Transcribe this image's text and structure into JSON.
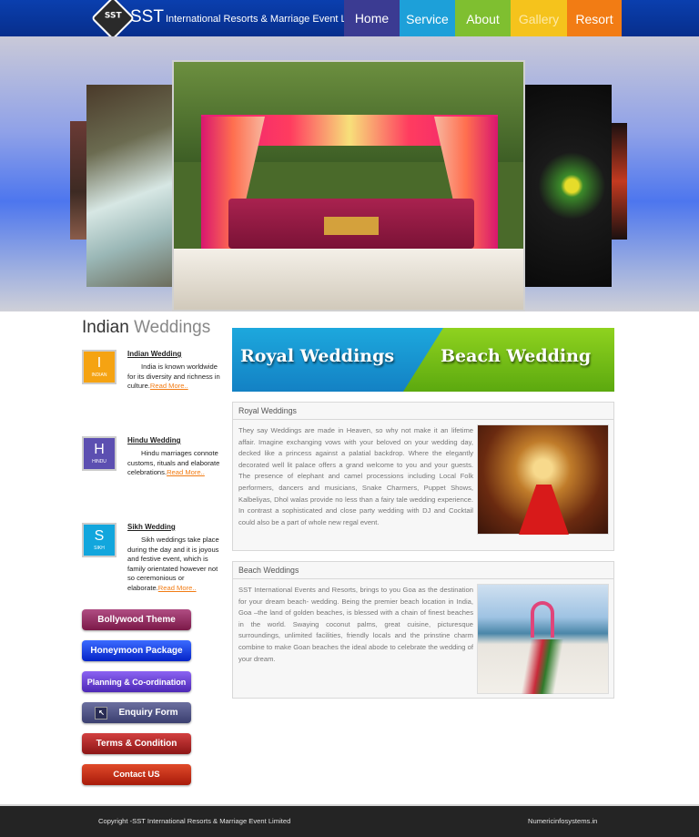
{
  "header": {
    "logo_badge": "SST",
    "brand_big": "SST",
    "brand_small": "International Resorts & Marriage Event Limited",
    "nav": [
      {
        "label": "Home"
      },
      {
        "label": "Service"
      },
      {
        "label": "About"
      },
      {
        "label": "Gallery"
      },
      {
        "label": "Resort"
      }
    ]
  },
  "sidebar": {
    "title_strong": "Indian",
    "title_light": "Weddings",
    "categories": [
      {
        "icon_letter": "I",
        "icon_sub": "INDIAN",
        "title": "Indian Wedding",
        "text": "India is known worldwide for its diversity and richness in culture.",
        "more": "Read More.."
      },
      {
        "icon_letter": "H",
        "icon_sub": "HINDU",
        "title": "Hindu Wedding",
        "text": "Hindu marriages connote customs, rituals and elaborate celebrations.",
        "more": "Read More.."
      },
      {
        "icon_letter": "S",
        "icon_sub": "SIKH",
        "title": "Sikh Wedding",
        "text": "Sikh weddings take place during the day and it is joyous and festive event, which is family orientated however not so ceremonious or elaborate.",
        "more": "Read More.."
      }
    ],
    "buttons": {
      "bollywood": "Bollywood Theme",
      "honeymoon": "Honeymoon Package",
      "planning": "Planning & Co-ordination",
      "enquiry": "Enquiry Form",
      "terms": "Terms & Condition",
      "contact": "Contact US"
    }
  },
  "promo": {
    "left": "Royal Weddings",
    "right": "Beach Wedding"
  },
  "royal": {
    "title": "Royal Weddings",
    "text": "They say Weddings are made in Heaven, so why not make it an lifetime affair. Imagine exchanging vows with your beloved on your wedding day, decked like a princess against a palatial backdrop. Where the elegantly decorated well lit palace offers a grand welcome to you and your guests. The presence of elephant and camel processions including Local Folk performers, dancers and musicians, Snake Charmers, Puppet Shows, Kalbeliyas, Dhol walas provide no less than a fairy tale wedding experience. In contrast a sophisticated and close party wedding with DJ and Cocktail could also be a part of whole new regal event."
  },
  "beach": {
    "title": "Beach Weddings",
    "text": "SST International Events and Resorts, brings to you Goa as the destination for your dream beach- wedding. Being the premier beach location in India, Goa –the land of golden beaches, is blessed with a chain of finest beaches in the world. Swaying coconut palms, great cuisine, picturesque surroundings, unlimited facilities, friendly locals and the prinstine charm combine to make Goan beaches the ideal abode to celebrate the wedding of your dream."
  },
  "footer": {
    "copyright": "Copyright -SST International Resorts & Marriage Event Limited",
    "credit": "Numericinfosystems.in"
  },
  "colors": {
    "header_blue": "#0a3fae",
    "nav_home": "#3b3b92",
    "nav_service": "#1da0d9",
    "nav_about": "#7fbf30",
    "nav_gallery": "#f5c31c",
    "nav_resort": "#f27c14",
    "link_orange": "#f27c14",
    "footer_bg": "#242424"
  }
}
